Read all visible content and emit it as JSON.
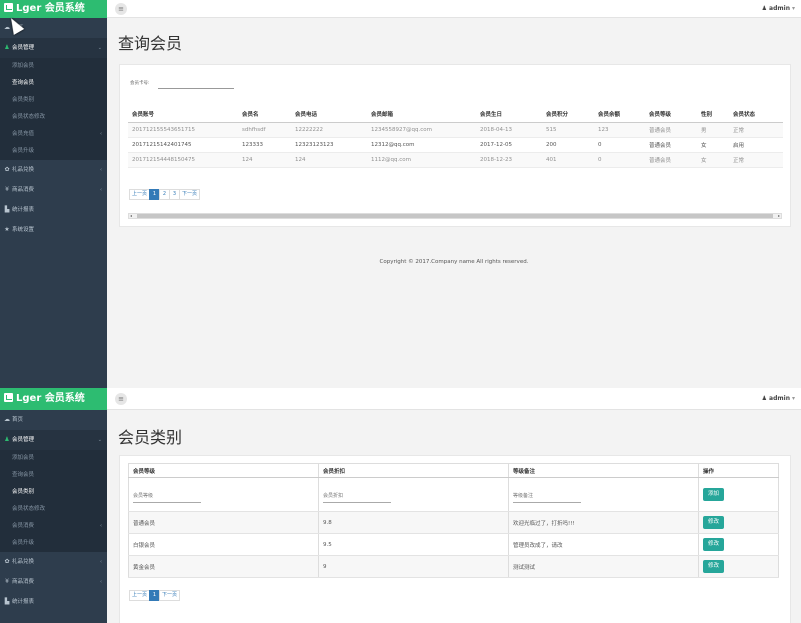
{
  "brand": "Lger 会员系统",
  "user": "admin",
  "nav": {
    "home": "首页",
    "member_mgmt": "会员管理",
    "sub1": [
      "添加会员",
      "查询会员",
      "会员类别",
      "会员状态修改",
      "会员充值",
      "会员升级"
    ],
    "sub2": [
      "添加会员",
      "查询会员",
      "会员类别",
      "会员状态修改",
      "会员消费",
      "会员升级"
    ],
    "gift": "礼品兑换",
    "consume": "商品消费",
    "stats": "统计报表",
    "system": "系统设置"
  },
  "page1": {
    "title": "查询会员",
    "search_label": "会员卡号:",
    "columns": [
      "会员账号",
      "会员名",
      "会员电话",
      "会员邮箱",
      "会员生日",
      "会员积分",
      "会员余额",
      "会员等级",
      "性别",
      "会员状态"
    ],
    "rows": [
      [
        "201712155543651715",
        "sdhfhsdf",
        "12222222",
        "1234558927@qq.com",
        "2018-04-13",
        "515",
        "123",
        "普通会员",
        "男",
        "正常"
      ],
      [
        "20171215142401745",
        "123333",
        "12323123123",
        "12312@qq.com",
        "2017-12-05",
        "200",
        "0",
        "普通会员",
        "女",
        "启用"
      ],
      [
        "201712154448150475",
        "124",
        "124",
        "1112@qq.com",
        "2018-12-23",
        "401",
        "0",
        "普通会员",
        "女",
        "正常"
      ]
    ],
    "pager": [
      "上一页",
      "1",
      "2",
      "3",
      "下一页"
    ],
    "footer": "Copyright © 2017.Company name All rights reserved."
  },
  "page2": {
    "title": "会员类别",
    "columns": [
      "会员等级",
      "会员折扣",
      "等级备注",
      "操作"
    ],
    "placeholders": [
      "会员等级",
      "会员折扣",
      "等级备注"
    ],
    "add_label": "添加",
    "rows": [
      [
        "普通会员",
        "9.8",
        "欢迎光临过了，打折吗!!!"
      ],
      [
        "白银会员",
        "9.5",
        "管理员改成了，请改"
      ],
      [
        "黄金会员",
        "9",
        "测试测试"
      ]
    ],
    "edit_label": "修改",
    "pager": [
      "上一页",
      "1",
      "下一页"
    ]
  }
}
